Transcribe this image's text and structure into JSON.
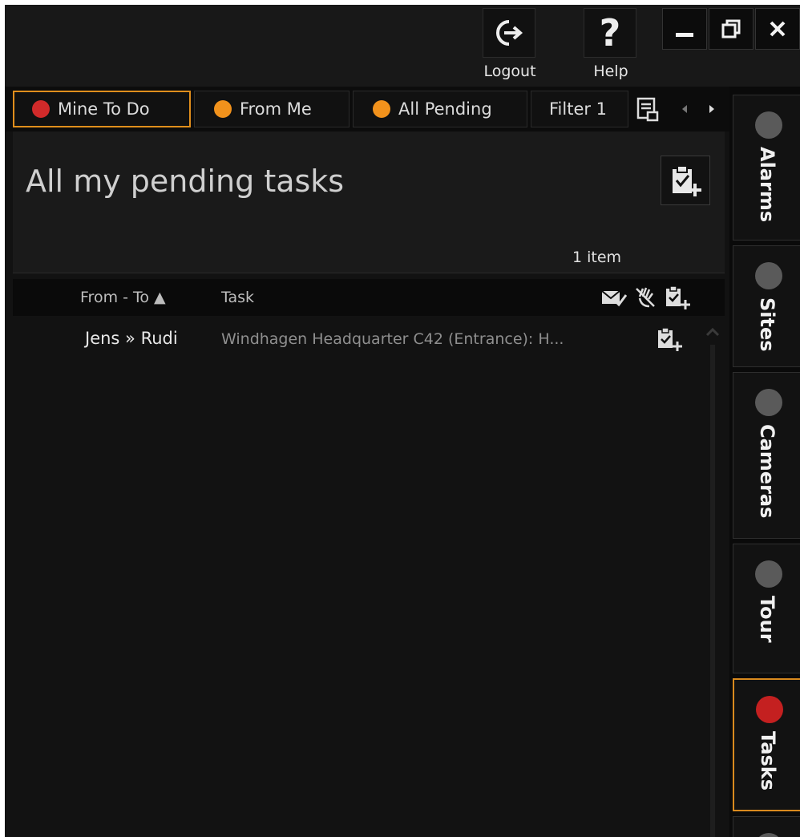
{
  "titlebar": {
    "logout_label": "Logout",
    "help_label": "Help"
  },
  "filter_tabs": [
    {
      "label": "Mine To Do",
      "dot_color": "#d12a2a",
      "active": true
    },
    {
      "label": "From Me",
      "dot_color": "#f2921c",
      "active": false
    },
    {
      "label": "All Pending",
      "dot_color": "#f2921c",
      "active": false
    },
    {
      "label": "Filter 1",
      "active": false
    }
  ],
  "header": {
    "title": "All my pending tasks",
    "item_count": "1 item"
  },
  "columns": {
    "from_to": "From - To ▲",
    "task": "Task"
  },
  "rows": [
    {
      "from_to": "Jens » Rudi",
      "task": "Windhagen Headquarter C42 (Entrance): H..."
    }
  ],
  "side_tabs": [
    {
      "label": "Alarms",
      "dot_color": "#5a5a5a"
    },
    {
      "label": "Sites",
      "dot_color": "#5a5a5a"
    },
    {
      "label": "Cameras",
      "dot_color": "#5a5a5a"
    },
    {
      "label": "Tour",
      "dot_color": "#5a5a5a"
    },
    {
      "label": "Tasks",
      "dot_color": "#c42020",
      "active": true
    }
  ],
  "colors": {
    "accent": "#e08e1c",
    "background": "#121212"
  }
}
